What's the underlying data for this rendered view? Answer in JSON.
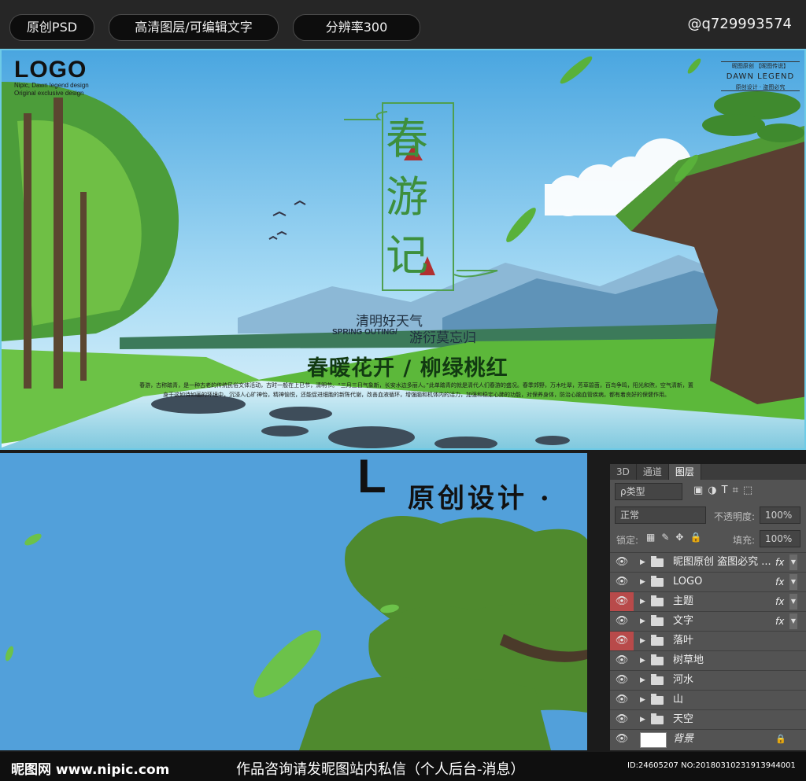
{
  "topbar": {
    "pills": [
      "原创PSD",
      "高清图层/可编辑文字",
      "分辨率300"
    ],
    "contact": "@q729993574"
  },
  "banner": {
    "logo": "LOGO",
    "logo_sub_1": "Nipic, Dawn legend design",
    "logo_sub_2": "Original exclusive design",
    "dawn_top": "昵图原创 【昵图传说】",
    "dawn_mid": "DAWN LEGEND",
    "dawn_bottom": "原创设计 · 盗图必究",
    "title_chars": [
      "春",
      "游",
      "记"
    ],
    "sub_cn_1": "清明好天气",
    "sub_en": "SPRING OUTING/",
    "sub_cn_2": "游衍莫忘归",
    "headline": "春暖花开 / 柳绿桃红",
    "body": "春游，古称踏青，是一种古老的传统民俗文体活动，古时一般在上巳节，清明节。“三月三日气象新，长安水边多丽人。”此单踏青的就是清代人们春游的盛况。春季郊野，万木吐翠，芳草碧茵，百鸟争鸣，阳光和煦，空气清新，置身于这如诗如画的环境中，沉浸人心旷神怡，精神愉悦，还能促进细胞的新陈代谢，改善血液循环，增强脑和机体内的活力，加强和稳定心肺的功能，对保养身体，防治心脑血管疾病，都有着良好的保健作用。"
  },
  "detail": {
    "L": "L",
    "text": "原创设计 ·"
  },
  "panel": {
    "tabs": [
      "3D",
      "通道",
      "图层"
    ],
    "kind_label": "ρ类型",
    "blend_mode": "正常",
    "opacity_label": "不透明度:",
    "opacity_value": "100%",
    "lock_label": "锁定:",
    "fill_label": "填充:",
    "fill_value": "100%",
    "layers": [
      {
        "name": "昵图原创 盗图必究 ...",
        "fx": "fx",
        "eye_red": false
      },
      {
        "name": "LOGO",
        "fx": "fx",
        "eye_red": false
      },
      {
        "name": "主题",
        "fx": "fx",
        "eye_red": true
      },
      {
        "name": "文字",
        "fx": "fx",
        "eye_red": false
      },
      {
        "name": "落叶",
        "fx": "",
        "eye_red": true
      },
      {
        "name": "树草地",
        "fx": "",
        "eye_red": false
      },
      {
        "name": "河水",
        "fx": "",
        "eye_red": false
      },
      {
        "name": "山",
        "fx": "",
        "eye_red": false
      },
      {
        "name": "天空",
        "fx": "",
        "eye_red": false
      },
      {
        "name": "背景",
        "fx": "",
        "eye_red": false
      }
    ]
  },
  "footer": {
    "site": "昵图网 www.nipic.com",
    "notice": "作品咨询请发昵图站内私信（个人后台-消息）",
    "id": "ID:24605207 NO:20180310231913944001"
  },
  "colors": {
    "sky": "#5fb5e6",
    "grass": "#5cb83a",
    "title_green": "#3d8f3d",
    "accent_red": "#b03030",
    "panel_bg": "#535353",
    "eye_red": "#b84a4a"
  }
}
